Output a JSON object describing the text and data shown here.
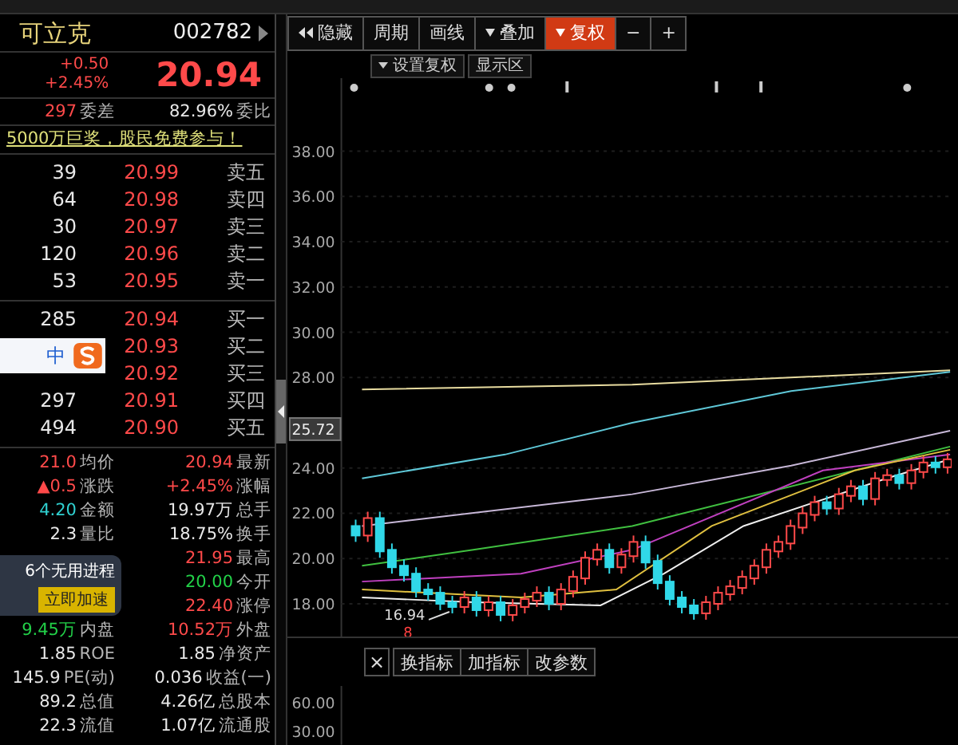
{
  "quote_header": {
    "code": "002782",
    "name": "可立克"
  },
  "price": {
    "last": "20.94",
    "change": "+0.50",
    "change_pct": "+2.45%"
  },
  "order_ratio": [
    {
      "label": "委差",
      "value": "297"
    },
    {
      "label": "委比",
      "value": "82.96%"
    }
  ],
  "promo_link": "5000万巨奖，股民免费参与！",
  "asks": [
    {
      "label": "卖五",
      "price": "20.99",
      "volume": "39"
    },
    {
      "label": "卖四",
      "price": "20.98",
      "volume": "64"
    },
    {
      "label": "卖三",
      "price": "20.97",
      "volume": "30"
    },
    {
      "label": "卖二",
      "price": "20.96",
      "volume": "120"
    },
    {
      "label": "卖一",
      "price": "20.95",
      "volume": "53"
    }
  ],
  "bids": [
    {
      "label": "买一",
      "price": "20.94",
      "volume": "285"
    },
    {
      "label": "买二",
      "price": "20.93"
    },
    {
      "label": "买三",
      "price": "20.92"
    },
    {
      "label": "买四",
      "price": "20.91",
      "volume": "297"
    },
    {
      "label": "买五",
      "price": "20.90",
      "volume": "494"
    }
  ],
  "stats": [
    {
      "items": [
        {
          "label": "均价",
          "value": "21.0",
          "color": "#ff4a4a"
        },
        {
          "label": "最新",
          "value": "20.94",
          "color": "#ff4a4a"
        }
      ]
    },
    {
      "items": [
        {
          "label": "涨跌",
          "value": "▲0.5",
          "color": "#ff4a4a"
        },
        {
          "label": "涨幅",
          "value": "+2.45%",
          "color": "#ff4a4a"
        }
      ]
    },
    {
      "items": [
        {
          "label": "金额",
          "value": "4.20",
          "color": "#30d0d0"
        },
        {
          "label": "总手",
          "value": "19.97万",
          "color": "#e8e8e8"
        }
      ]
    },
    {
      "items": [
        {
          "label": "量比",
          "value": "2.3",
          "color": "#e8e8e8"
        },
        {
          "label": "换手",
          "value": "18.75%",
          "color": "#e8e8e8"
        }
      ]
    },
    {
      "items": [
        {
          "label": "最高",
          "value": "21.95",
          "color": "#ff4a4a"
        }
      ]
    },
    {
      "items": [
        {
          "label": "今开",
          "value": "20.00",
          "color": "#22d048"
        }
      ]
    },
    {
      "items": [
        {
          "label": "涨停",
          "value": "22.40",
          "color": "#ff4a4a"
        }
      ]
    },
    {
      "items": [
        {
          "label": "内盘",
          "value": "9.45万",
          "color": "#22d048"
        },
        {
          "label": "外盘",
          "value": "10.52万",
          "color": "#ff4a4a"
        }
      ]
    },
    {
      "items": [
        {
          "label": "ROE",
          "value": "1.85",
          "color": "#e8e8e8"
        },
        {
          "label": "净资产",
          "value": "1.85",
          "color": "#e8e8e8"
        }
      ]
    },
    {
      "items": [
        {
          "label": "PE(动)",
          "value": "145.9",
          "color": "#e8e8e8"
        },
        {
          "label": "收益(一)",
          "value": "0.036",
          "color": "#e8e8e8"
        }
      ]
    },
    {
      "items": [
        {
          "label": "总值",
          "value": "89.2",
          "color": "#e8e8e8"
        },
        {
          "label": "总股本",
          "value": "4.26亿",
          "color": "#e8e8e8"
        }
      ]
    },
    {
      "items": [
        {
          "label": "流值",
          "value": "22.3",
          "color": "#e8e8e8"
        },
        {
          "label": "流通股",
          "value": "1.07亿",
          "color": "#e8e8e8"
        }
      ]
    }
  ],
  "ime_bar": {
    "text": "中"
  },
  "cleanup_popup": {
    "message": "6个无用进程",
    "button": "立即加速"
  },
  "toolbar": [
    {
      "label": "隐藏",
      "kind": "collapse",
      "dropdown": false,
      "selected": false
    },
    {
      "label": "周期",
      "kind": "text",
      "dropdown": false,
      "selected": false
    },
    {
      "label": "画线",
      "kind": "text",
      "dropdown": false,
      "selected": false
    },
    {
      "label": "叠加",
      "kind": "text",
      "dropdown": true,
      "selected": false
    },
    {
      "label": "复权",
      "kind": "text",
      "dropdown": true,
      "selected": true
    },
    {
      "label": "−",
      "kind": "text",
      "dropdown": false,
      "selected": false
    },
    {
      "label": "+",
      "kind": "text",
      "dropdown": false,
      "selected": false
    }
  ],
  "sub_toolbar": [
    {
      "label": "设置复权",
      "dropdown": true
    },
    {
      "label": "显示区",
      "dropdown": false
    }
  ],
  "price_axis": {
    "ticks": [
      "38.00",
      "36.00",
      "34.00",
      "32.00",
      "30.00",
      "28.00",
      "24.00",
      "22.00",
      "20.00",
      "18.00"
    ],
    "current": "25.72"
  },
  "low_marker": {
    "label": "16.94",
    "count": "8"
  },
  "indicator_buttons": [
    {
      "label": "×",
      "kind": "close"
    },
    {
      "label": "换指标",
      "kind": "text"
    },
    {
      "label": "加指标",
      "kind": "text"
    },
    {
      "label": "改参数",
      "kind": "text"
    }
  ],
  "indicator_axis": {
    "ticks": [
      "60.00",
      "30.00"
    ]
  }
}
